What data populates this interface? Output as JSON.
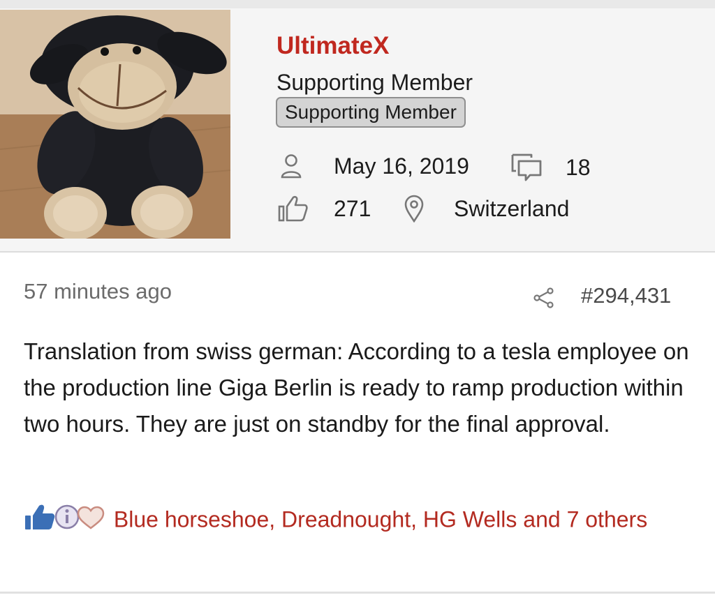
{
  "user": {
    "username": "UltimateX",
    "title": "Supporting Member",
    "badge": "Supporting Member",
    "joined": "May 16, 2019",
    "messages": "18",
    "reaction_score": "271",
    "location": "Switzerland",
    "username_color": "#c0281f"
  },
  "post": {
    "time": "57 minutes ago",
    "number": "#294,431",
    "body": "Translation from swiss german: According to a tesla employee on the production line Giga Berlin is ready to ramp production within two hours. They are just on standby for the final approval.",
    "reactions_text": "Blue horseshoe, Dreadnought, HG Wells and 7 others",
    "reaction_icons": [
      "like-icon",
      "informative-icon",
      "love-icon"
    ],
    "reactions_color": "#b32a20"
  },
  "icons": {
    "joined": "person-icon",
    "messages": "speech-bubble-icon",
    "reaction_score": "thumbs-up-icon",
    "location": "map-pin-icon",
    "share": "share-icon"
  }
}
